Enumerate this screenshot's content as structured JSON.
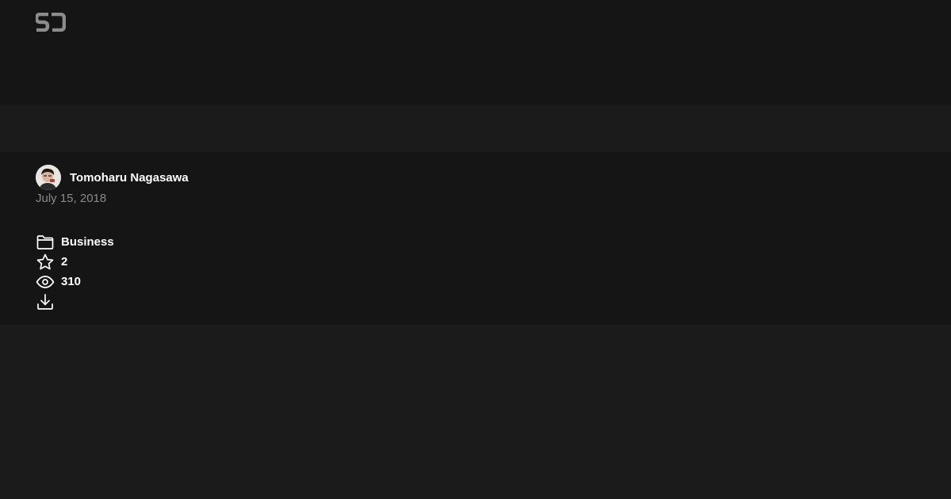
{
  "header": {
    "logo_icon": "sd-logo-icon"
  },
  "author": {
    "name": "Tomoharu Nagasawa",
    "avatar_icon": "avatar"
  },
  "published_date": "July 15, 2018",
  "meta": {
    "category": "Business",
    "stars": "2",
    "views": "310",
    "icons": {
      "category": "folder-icon",
      "stars": "star-icon",
      "views": "eye-icon",
      "download": "download-icon"
    }
  },
  "colors": {
    "header_bg": "#151515",
    "page_bg": "#1b1b1b",
    "text_primary": "#ffffff",
    "text_muted": "#8a8a8a",
    "logo": "#8c8c8c"
  }
}
